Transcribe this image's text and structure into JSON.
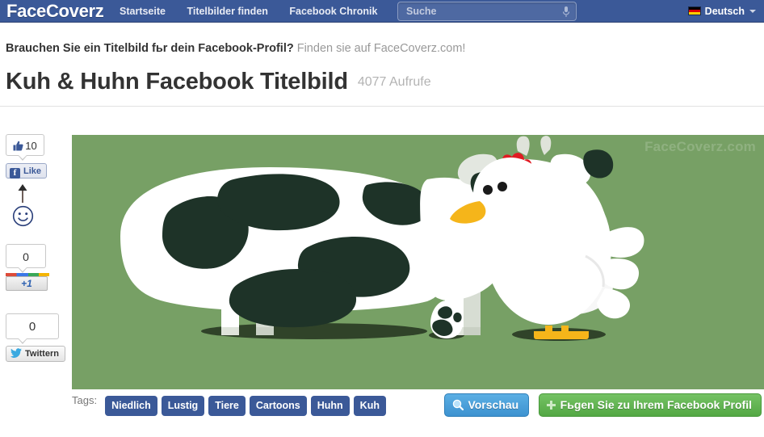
{
  "header": {
    "brand": "FaceCoverz",
    "nav": [
      {
        "label": "Startseite"
      },
      {
        "label": "Titelbilder finden"
      },
      {
        "label": "Facebook Chronik"
      }
    ],
    "search": {
      "value": "",
      "placeholder": "Suche",
      "icon": "microphone-icon"
    },
    "language": {
      "label": "Deutsch",
      "flag": "german-flag-icon",
      "caret": "chevron-down-icon"
    }
  },
  "tagline": {
    "bold": "Brauchen Sie ein Titelbild fьr dein Facebook-Profil?",
    "rest": " Finden sie auf FaceCoverz.com!"
  },
  "title": {
    "text": "Kuh & Huhn Facebook Titelbild",
    "views": "4077 Aufrufe"
  },
  "social": {
    "facebook": {
      "count": "10",
      "button_label": "Like",
      "icon": "thumbs-up-icon",
      "brand_icon": "facebook-f-icon"
    },
    "googleplus": {
      "count": "0",
      "button_label": "+1"
    },
    "twitter": {
      "count": "0",
      "button_label": "Twittern",
      "icon": "twitter-bird-icon"
    }
  },
  "cover": {
    "watermark": "FaceCoverz.com",
    "background_color": "#77a065",
    "spot_color": "#1e3328",
    "body_color": "#ffffff",
    "comb_color": "#e01b22",
    "beak_color": "#f5b51a",
    "alt": "Cartoon cow and chicken with spotted egg on green field"
  },
  "tags": {
    "label": "Tags:",
    "items": [
      {
        "label": "Niedlich"
      },
      {
        "label": "Lustig"
      },
      {
        "label": "Tiere"
      },
      {
        "label": "Cartoons"
      },
      {
        "label": "Huhn"
      },
      {
        "label": "Kuh"
      }
    ]
  },
  "actions": {
    "preview": {
      "label": "Vorschau",
      "icon": "magnifier-icon",
      "color": "#3d92d0"
    },
    "add": {
      "label": "Fьgen Sie zu Ihrem Facebook Profil",
      "icon": "plus-icon",
      "color": "#53a844"
    }
  }
}
